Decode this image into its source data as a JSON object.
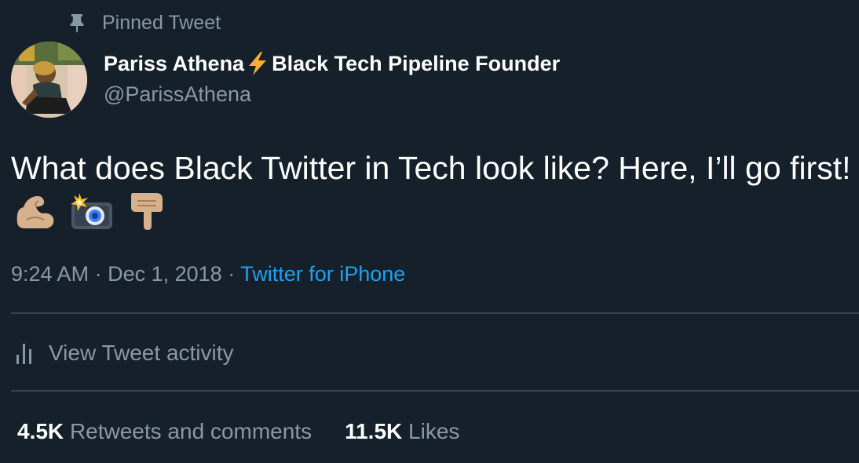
{
  "pinned": {
    "label": "Pinned Tweet",
    "icon": "pin-icon"
  },
  "author": {
    "name_part1": "Pariss Athena",
    "name_emoji": "lightning-bolt-icon",
    "name_part2": "Black Tech Pipeline Founder",
    "handle": "@ParissAthena"
  },
  "tweet": {
    "text_line": "What does Black Twitter in Tech look like? Here, I’ll go first!",
    "emojis": [
      "flexed-biceps-icon",
      "camera-with-flash-icon",
      "pointing-down-icon"
    ]
  },
  "meta": {
    "time": "9:24 AM",
    "separator": "·",
    "date": "Dec 1, 2018",
    "source": "Twitter for iPhone"
  },
  "activity": {
    "label": "View Tweet activity",
    "icon": "bar-chart-icon"
  },
  "stats": {
    "retweets_count": "4.5K",
    "retweets_label": "Retweets and comments",
    "likes_count": "11.5K",
    "likes_label": "Likes"
  },
  "colors": {
    "background": "#15202b",
    "text_primary": "#ffffff",
    "text_secondary": "#8899a6",
    "link": "#1da1f2",
    "divider": "#38444d"
  }
}
